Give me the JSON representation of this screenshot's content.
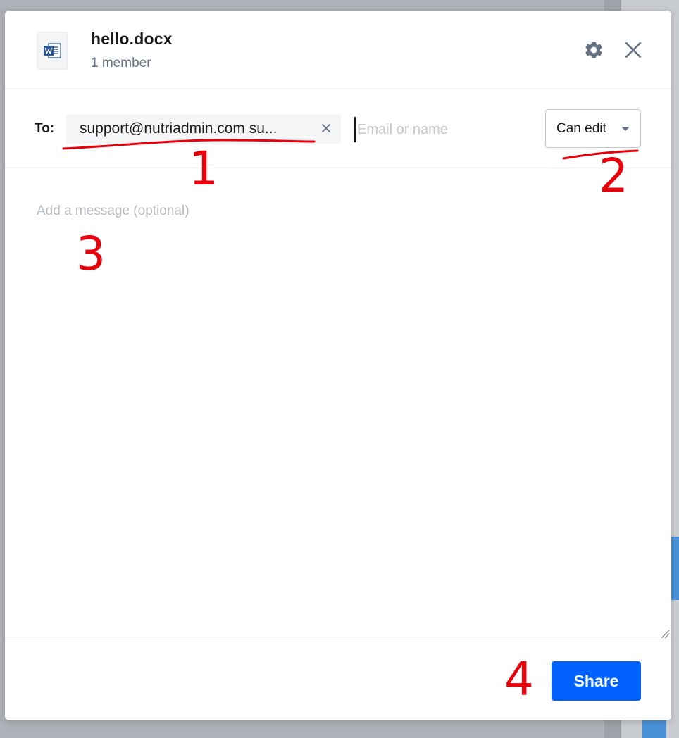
{
  "dialog": {
    "file_name": "hello.docx",
    "member_count": "1 member",
    "file_icon": "word-document-icon",
    "settings_icon": "gear-icon",
    "close_icon": "close-icon"
  },
  "recipients": {
    "to_label": "To:",
    "chips": [
      {
        "text": "support@nutriadmin.com su..."
      }
    ],
    "input_placeholder": "Email or name",
    "permission": "Can edit"
  },
  "message": {
    "placeholder": "Add a message (optional)"
  },
  "footer": {
    "share_label": "Share"
  },
  "annotations": {
    "labels": [
      "1",
      "2",
      "3",
      "4"
    ],
    "color": "#e8000b"
  },
  "colors": {
    "primary_button": "#0061fe",
    "text": "#1e1919",
    "muted_text": "#637282",
    "divider": "#e3e5e8"
  }
}
